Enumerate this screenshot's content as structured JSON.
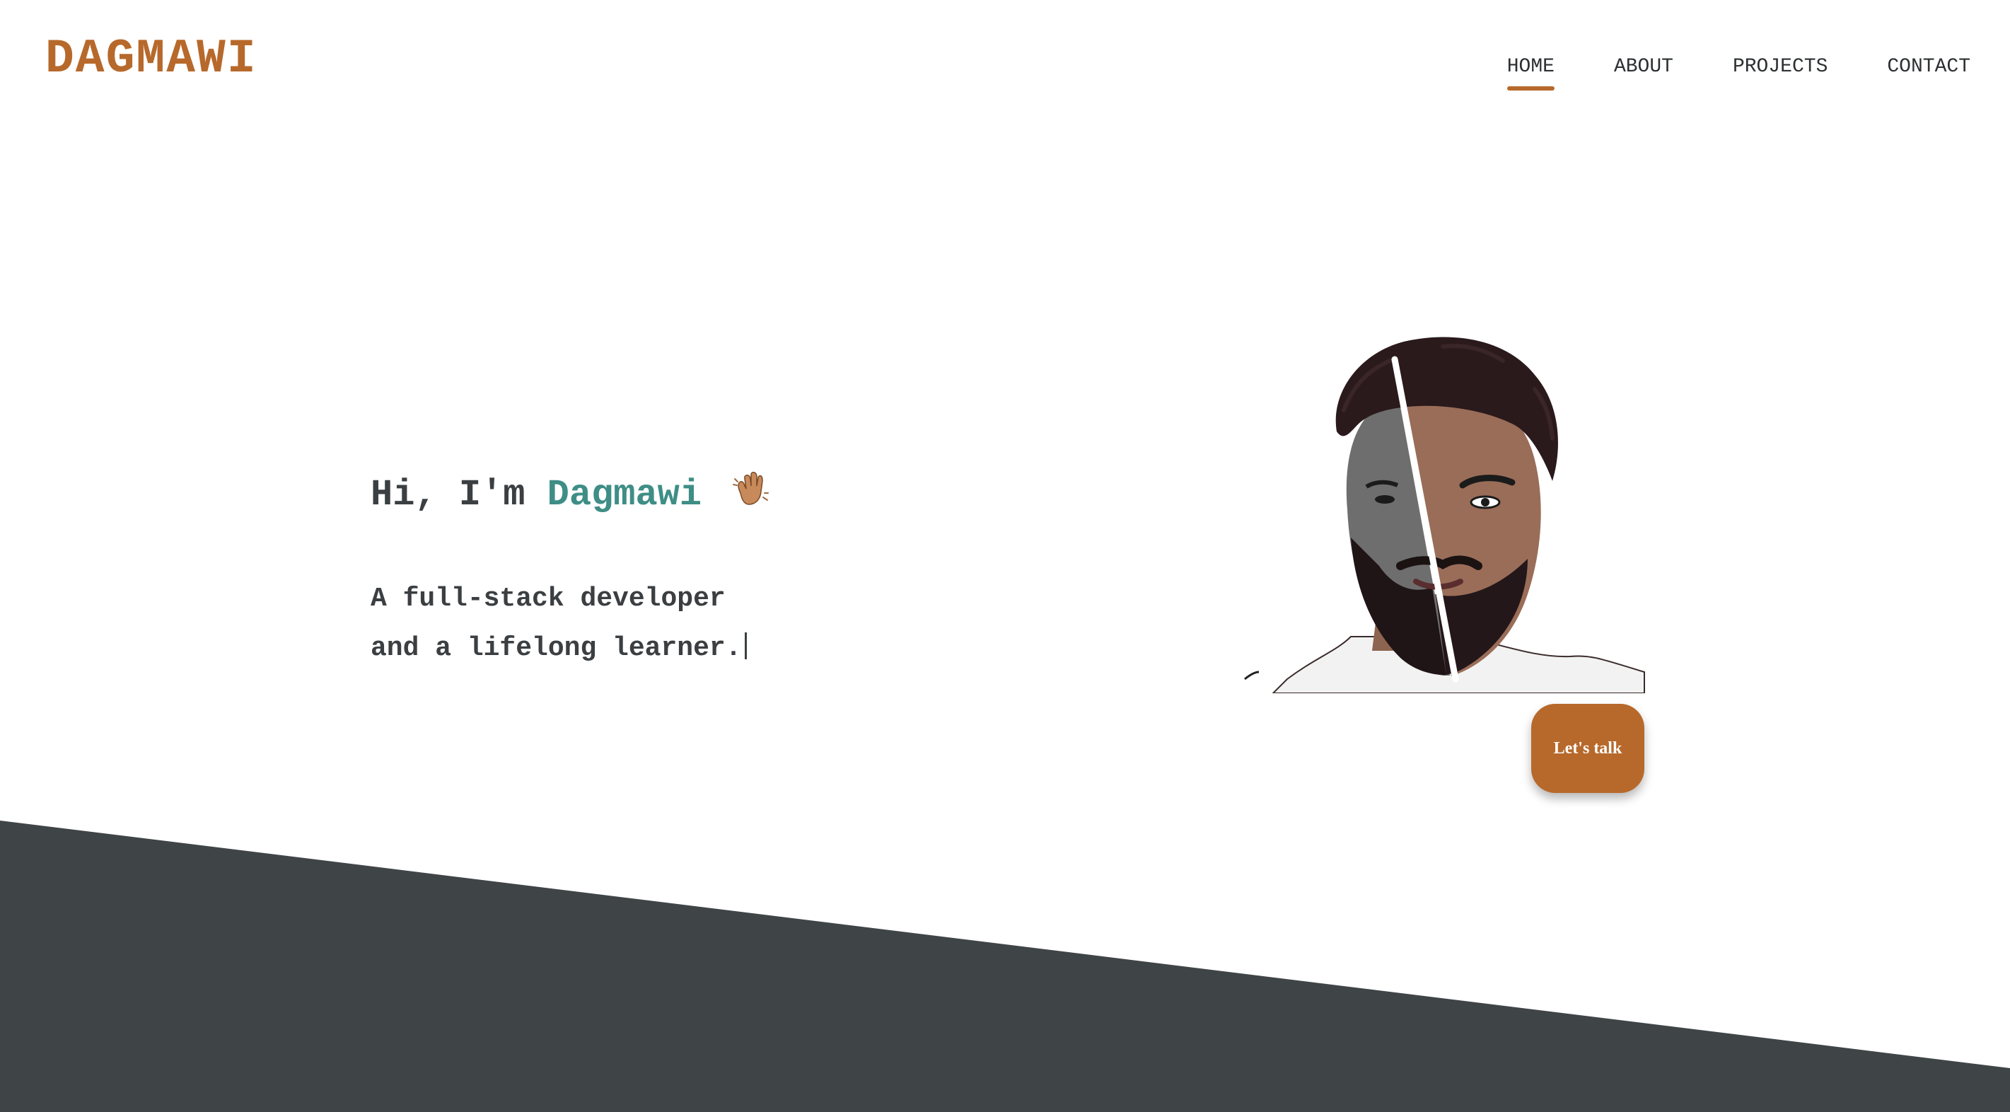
{
  "brand": {
    "logo_text": "DAGMAWI"
  },
  "nav": {
    "items": [
      {
        "label": "HOME",
        "active": true
      },
      {
        "label": "ABOUT",
        "active": false
      },
      {
        "label": "PROJECTS",
        "active": false
      },
      {
        "label": "CONTACT",
        "active": false
      }
    ]
  },
  "hero": {
    "greeting_prefix": "Hi, I'm",
    "name": "Dagmawi",
    "wave_icon": "waving-hand-icon",
    "tagline_line1": "A full-stack developer",
    "tagline_line2": "and a lifelong learner.",
    "portrait_icon": "portrait-illustration",
    "cta_label": "Let's talk"
  },
  "colors": {
    "accent": "#b7692b",
    "name_color": "#3e8e86",
    "text": "#3b3f42",
    "band": "#3f4447",
    "background": "#ffffff"
  }
}
